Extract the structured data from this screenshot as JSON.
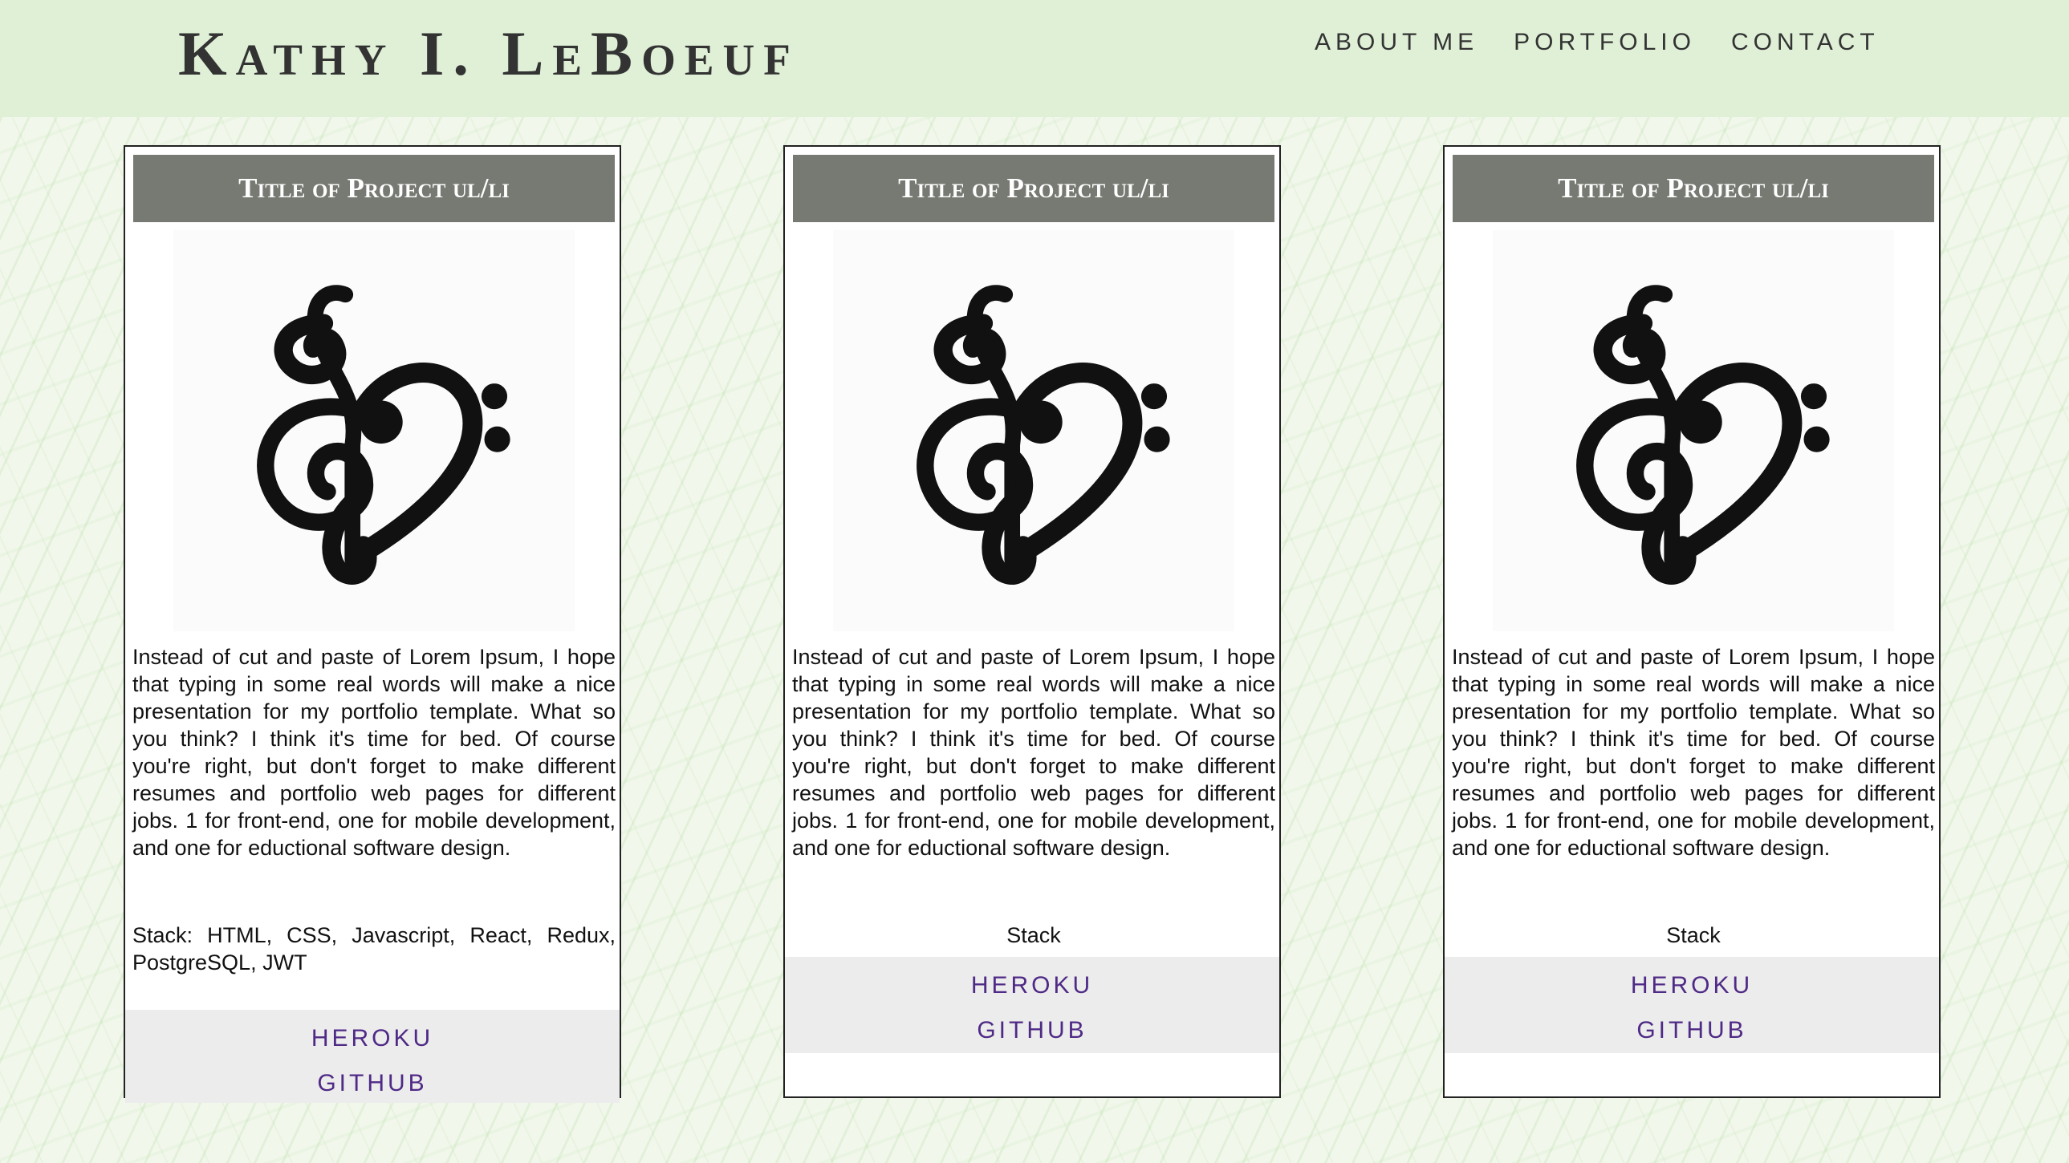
{
  "header": {
    "name": "Kathy I. LeBoeuf",
    "nav": [
      "About Me",
      "Portfolio",
      "Contact"
    ]
  },
  "projects": [
    {
      "title": "Title of Project ul/li",
      "description": "Instead of cut and paste of Lorem Ipsum, I hope that typing in some real words will make a nice presentation for my portfolio template. What so you think? I think it's time for bed. Of course you're right, but don't forget to make different resumes and portfolio web pages for different jobs. 1 for front-end, one for mobile development, and one for eductional software design.",
      "stack": "Stack: HTML, CSS, Javascript, React, Redux, PostgreSQL, JWT",
      "links": [
        "HEROKU",
        "GITHUB"
      ]
    },
    {
      "title": "Title of Project ul/li",
      "description": "Instead of cut and paste of Lorem Ipsum, I hope that typing in some real words will make a nice presentation for my portfolio template. What so you think? I think it's time for bed. Of course you're right, but don't forget to make different resumes and portfolio web pages for different jobs. 1 for front-end, one for mobile development, and one for eductional software design.",
      "stack": "Stack",
      "links": [
        "HEROKU",
        "GITHUB"
      ]
    },
    {
      "title": "Title of Project ul/li",
      "description": "Instead of cut and paste of Lorem Ipsum, I hope that typing in some real words will make a nice presentation for my portfolio template. What so you think? I think it's time for bed. Of course you're right, but don't forget to make different resumes and portfolio web pages for different jobs. 1 for front-end, one for mobile development, and one for eductional software design.",
      "stack": "Stack",
      "links": [
        "HEROKU",
        "GITHUB"
      ]
    }
  ],
  "colors": {
    "header_bg": "#dff0d6",
    "title_bar": "#777a72",
    "link": "#4f2a86",
    "link_bar": "#ececec"
  }
}
